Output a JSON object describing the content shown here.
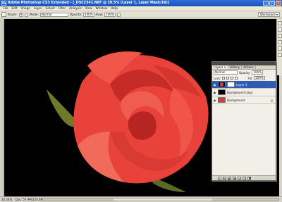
{
  "window": {
    "app_icon": "Ps",
    "title": "Adobe Photoshop CS3 Extended - [_DSC2342.NEF @ 20.5% (Layer 1, Layer Mask/16)]",
    "buttons": {
      "minimize": "_",
      "maximize": "□",
      "close": "×"
    }
  },
  "menu": [
    "File",
    "Edit",
    "Image",
    "Layer",
    "Select",
    "Filter",
    "Analysis",
    "View",
    "Window",
    "Help"
  ],
  "options": {
    "brush_label": "Brush:",
    "brush_value": "9",
    "mode_label": "Mode:",
    "mode_value": "Normal",
    "opacity_label": "Opacity:",
    "opacity_value": "100%",
    "flow_label": "Flow:",
    "flow_value": "100%",
    "workspace": "Workspace ▾"
  },
  "layers_panel": {
    "tabs": [
      "Layers ×",
      "History",
      "Actions"
    ],
    "blend_mode": "Normal",
    "opacity_label": "Opacity:",
    "opacity_value": "100%",
    "lock_label": "Lock:",
    "fill_label": "Fill:",
    "fill_value": "100%",
    "layers": [
      {
        "name": "Layer 1",
        "selected": true
      },
      {
        "name": "Background copy",
        "selected": false
      },
      {
        "name": "Background",
        "selected": false
      }
    ],
    "lock_glyph": "🔒",
    "eye_glyph": "◉",
    "bottom_buttons": [
      "∞",
      "fx",
      "◐",
      "◑",
      "▭",
      "❏",
      "🗑"
    ]
  },
  "status": {
    "zoom": "20.54%",
    "doc": "Doc: 57.9M/120.6M"
  },
  "colors": {
    "title_bar": "#1d4fb8",
    "selected_layer": "#2d5cb2",
    "canvas_bg": "#000000",
    "rose": "#e8423a"
  },
  "icons": {
    "tool": "brush-tool-icon",
    "eye": "eye-visibility-icon",
    "lock": "lock-icon"
  }
}
